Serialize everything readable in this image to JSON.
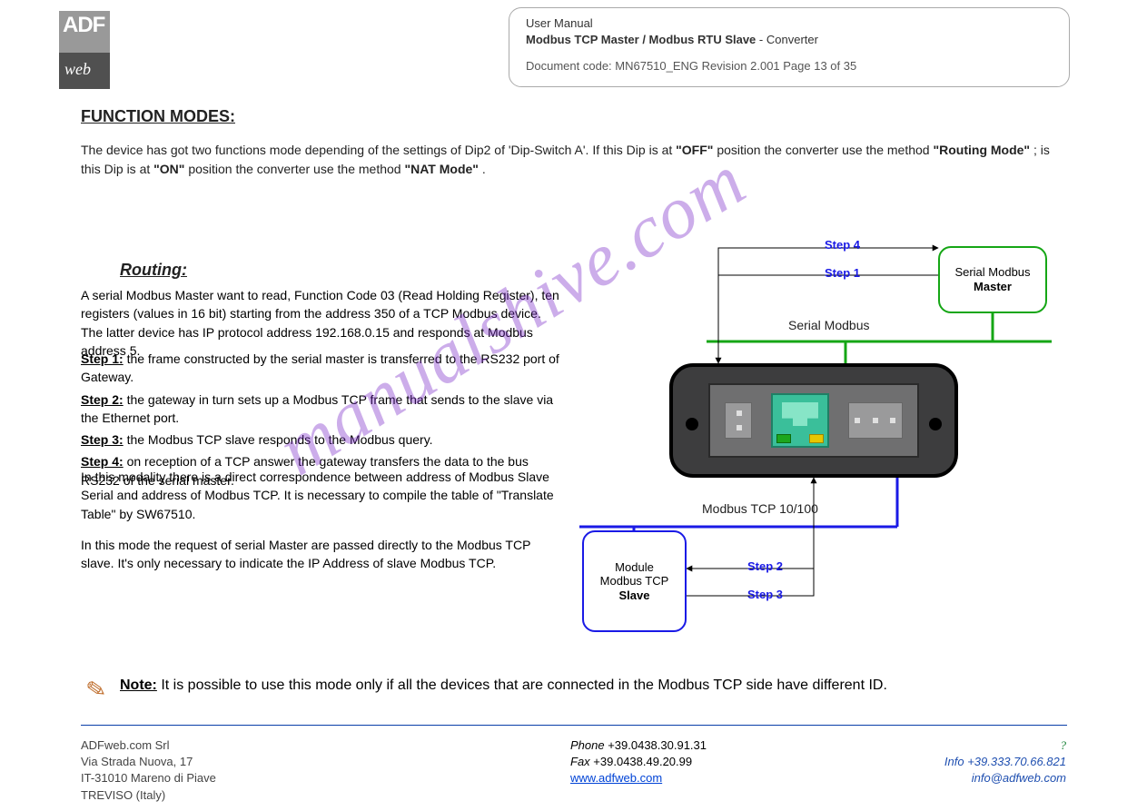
{
  "logo": {
    "top": "ADF",
    "bot": "web"
  },
  "header_box": {
    "l1": "User Manual",
    "l2a": "Modbus TCP Master / Modbus RTU Slave",
    "l2b": " - Converter",
    "doc": "Document code: MN67510_ENG   Revision 2.001   Page 13 of 35"
  },
  "section1": "FUNCTION MODES:",
  "intro_a": "The device has got two functions mode depending of the settings of Dip2 of 'Dip-Switch A'. If this Dip is at ",
  "intro_off": "\"OFF\"",
  "intro_b": " position the converter use the method ",
  "intro_rm": "\"Routing Mode\"",
  "intro_c": "; is this Dip is at ",
  "intro_on": "\"ON\"",
  "intro_d": " position the converter use the method ",
  "intro_nm": "\"NAT Mode\"",
  "intro_e": ".",
  "section2": "Routing:",
  "block1": "A serial Modbus Master want to read, Function Code 03 (Read Holding Register), ten registers (values in 16 bit) starting from the address 350 of a TCP Modbus device. The latter device has IP protocol address 192.168.0.15 and responds at Modbus address 5.",
  "steps": [
    {
      "n": "Step 1:",
      "t": " the frame constructed by the serial master is transferred to the RS232 port of Gateway."
    },
    {
      "n": "Step 2:",
      "t": " the gateway in turn sets up a Modbus TCP frame that sends to the slave via the Ethernet port."
    },
    {
      "n": "Step 3:",
      "t": " the Modbus TCP slave responds to the Modbus query."
    },
    {
      "n": "Step 4:",
      "t": " on reception of a TCP answer the gateway transfers the data to the bus RS232 of the serial master."
    }
  ],
  "block2": "In this modality there is a direct correspondence between address of Modbus Slave Serial and address of Modbus TCP. It is necessary to compile the table of \"Translate Table\" by SW67510.",
  "block3": "In this mode the request of serial Master are passed directly to the Modbus TCP slave. It's only necessary to indicate the IP Address of slave Modbus TCP.",
  "note_label": "Note:",
  "note_text": " It is possible to use this mode only if all the devices that are connected in the Modbus TCP side have different ID.",
  "footer": {
    "company": "ADFweb.com Srl",
    "addr1": "Via Strada Nuova, 17",
    "addr2": "IT-31010 Mareno di Piave",
    "addr3": "TREVISO (Italy)",
    "phone_lbl": "Phone ",
    "phone": "+39.0438.30.91.31",
    "fax_lbl": "Fax ",
    "fax": "+39.0438.49.20.99",
    "www": "www.adfweb.com",
    "ask": "?",
    "tel_lbl": "Info ",
    "tel": "+39.333.70.66.821",
    "email": "info@adfweb.com"
  },
  "diagram": {
    "master_l1": "Serial Modbus",
    "master_l2": "Master",
    "slave_l1": "Module",
    "slave_l2": "Modbus TCP",
    "slave_l3": "Slave",
    "bus1": "Serial Modbus",
    "bus2": "Modbus TCP 10/100",
    "s1": "Step 1",
    "s2": "Step 2",
    "s3": "Step 3",
    "s4": "Step 4"
  },
  "watermark": "manualshive.com"
}
